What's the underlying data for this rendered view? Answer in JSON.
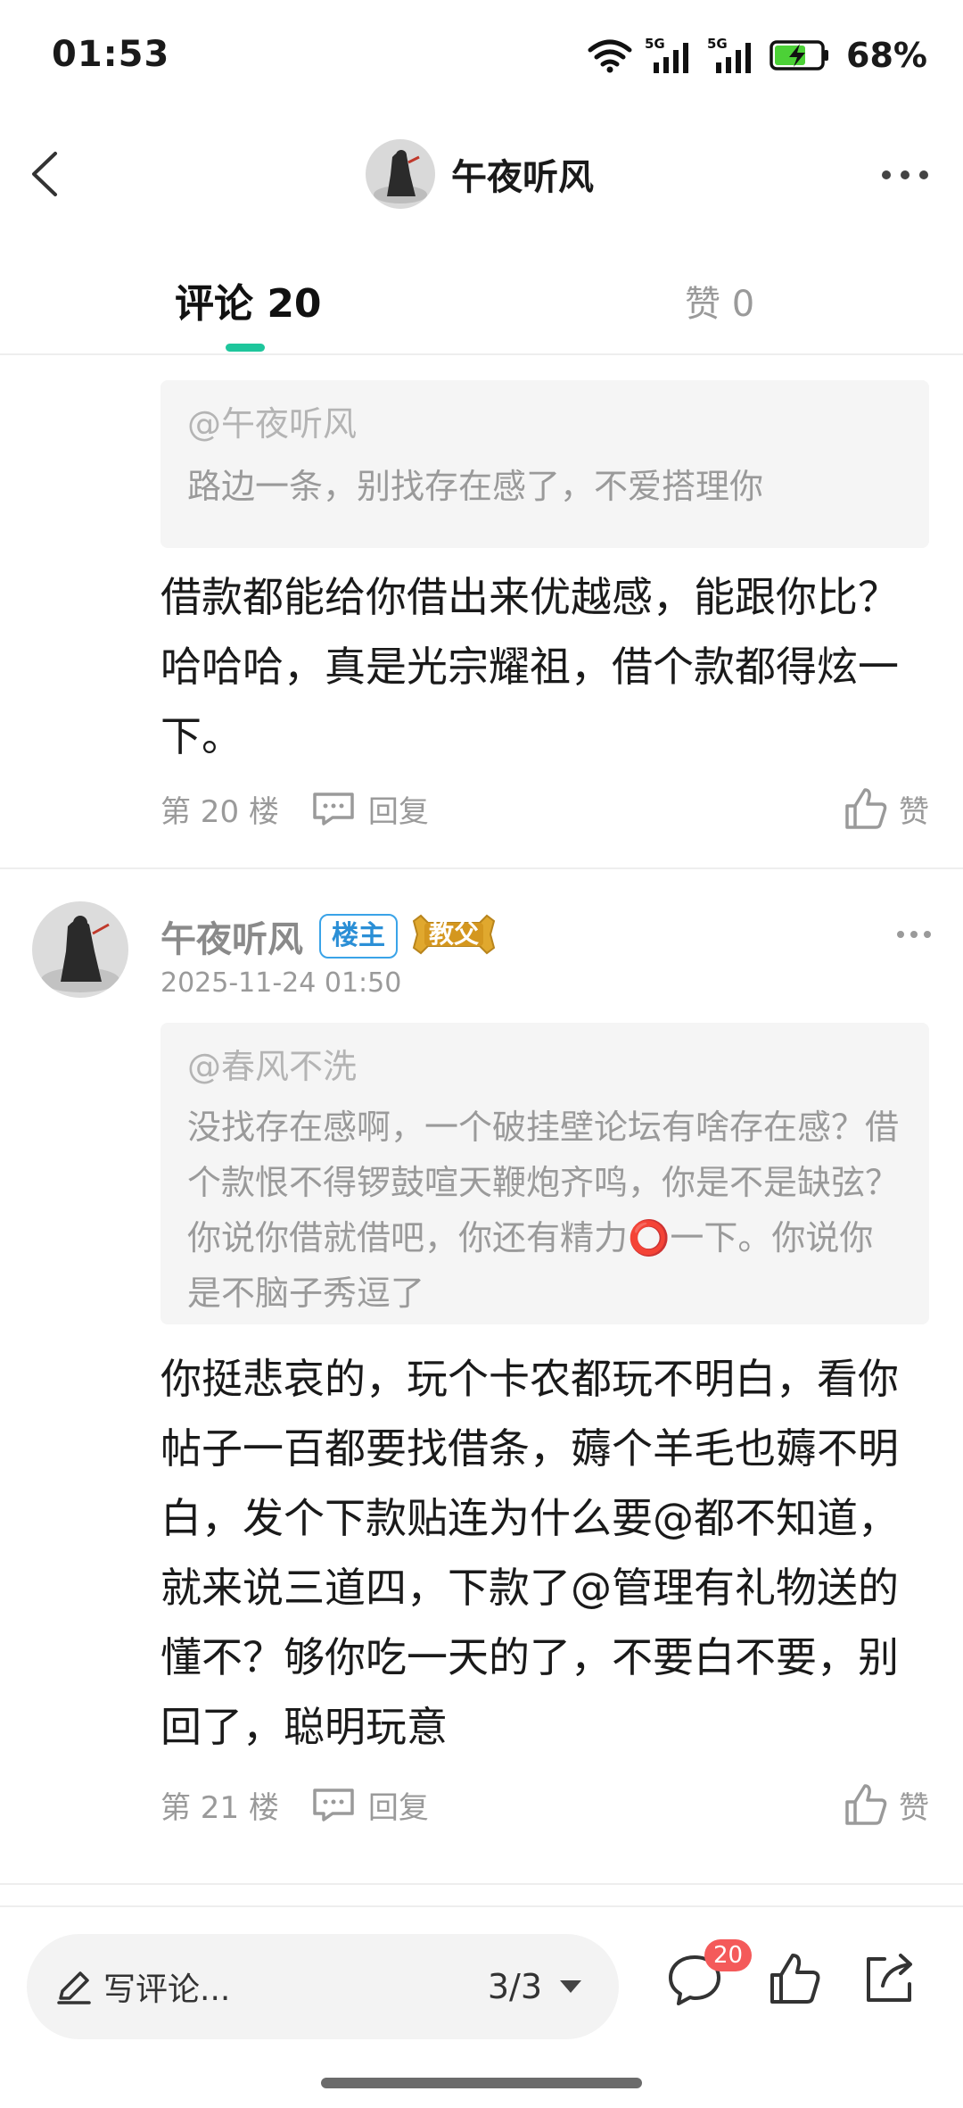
{
  "status_bar": {
    "time": "01:53",
    "network_1": "5G",
    "network_2": "5G",
    "battery": "68%",
    "icons": [
      "wifi-icon",
      "signal-5g-icon",
      "signal-5g-icon",
      "battery-charging-icon"
    ]
  },
  "header": {
    "title": "午夜听风",
    "icons": [
      "back-arrow-icon",
      "more-dots-icon"
    ]
  },
  "tabs": [
    {
      "label": "评论 20",
      "active": true
    },
    {
      "label": "赞 0",
      "active": false
    }
  ],
  "comments": [
    {
      "quote_user": "@午夜听风",
      "quote_text": "路边一条，别找存在感了，不爱搭理你",
      "body": "借款都能给你借出来优越感，能跟你比？哈哈哈，真是光宗耀祖，借个款都得炫一下。",
      "floor": "第 20 楼",
      "reply_label": "回复",
      "like_label": "赞"
    },
    {
      "author": "午夜听风",
      "owner_badge": "楼主",
      "rank_badge": "教父",
      "date": "2025-11-24 01:50",
      "quote_user": "@春风不洗",
      "quote_text": "没找存在感啊，一个破挂壁论坛有啥存在感？借个款恨不得锣鼓喧天鞭炮齐鸣，你是不是缺弦？你说你借就借吧，你还有精力⭕一下。你说你是不脑子秀逗了",
      "body": "你挺悲哀的，玩个卡农都玩不明白，看你帖子一百都要找借条，薅个羊毛也薅不明白，发个下款贴连为什么要@都不知道，就来说三道四，下款了@管理有礼物送的懂不？够你吃一天的了，不要白不要，别回了，聪明玩意",
      "floor": "第 21 楼",
      "reply_label": "回复",
      "like_label": "赞"
    }
  ],
  "bottom_bar": {
    "input_placeholder": "写评论...",
    "page": "3/3",
    "comment_count": "20",
    "icons": [
      "pencil-icon",
      "dropdown-triangle-icon",
      "comment-bubble-icon",
      "thumbs-up-icon",
      "share-icon"
    ]
  },
  "colors": {
    "accent": "#1ec69c",
    "badge_red": "#f45a5a",
    "owner_badge_blue": "#2b8fd6",
    "rank_badge_gold": "#d9a227"
  }
}
